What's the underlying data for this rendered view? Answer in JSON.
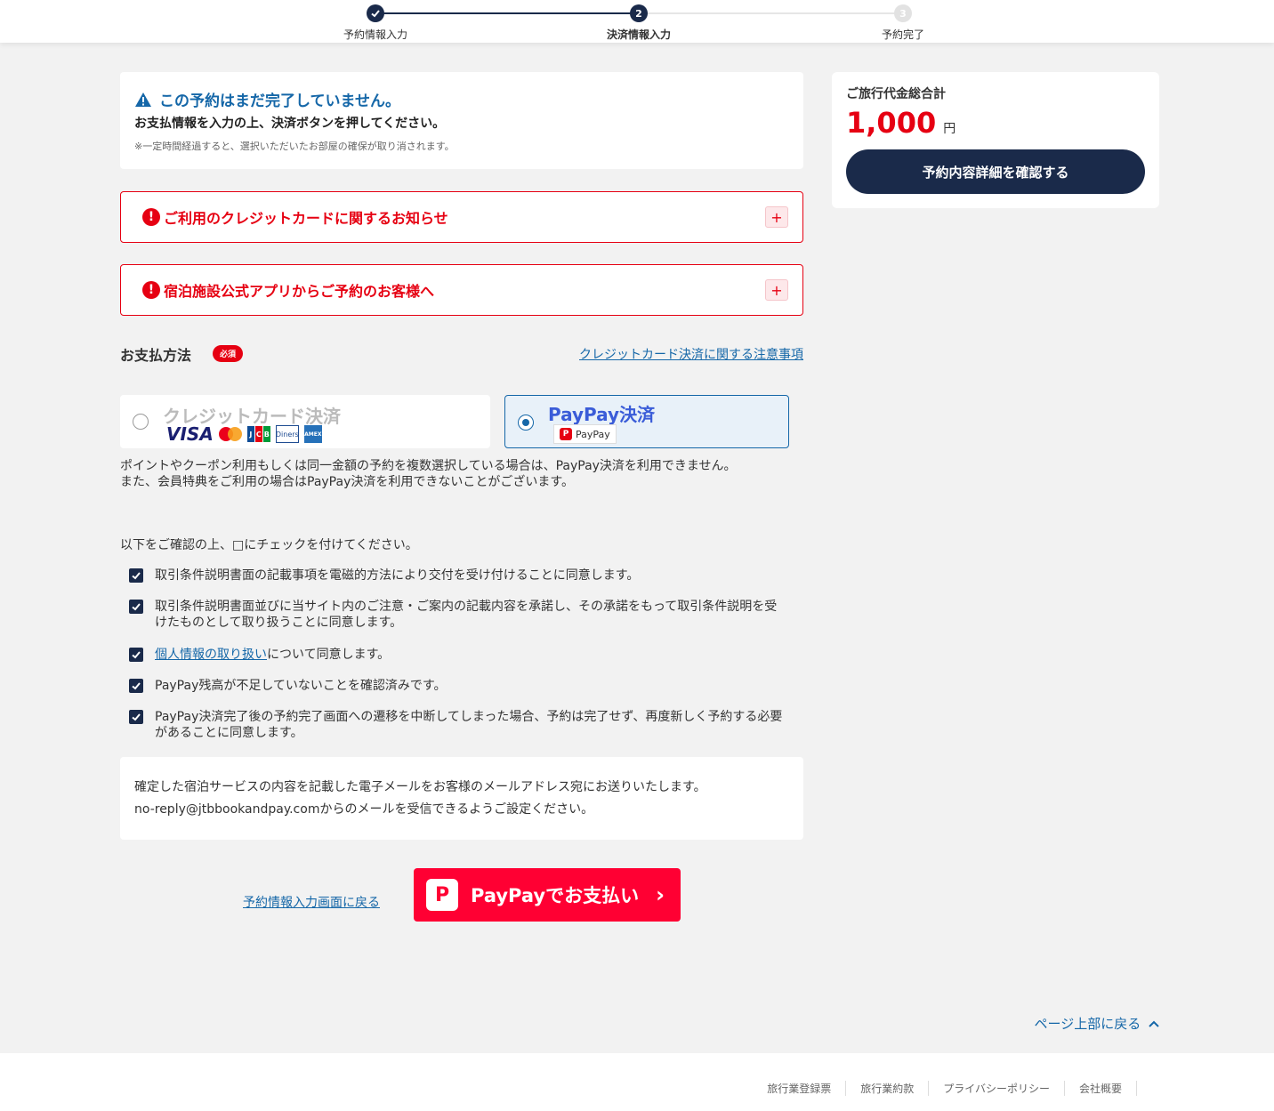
{
  "stepper": {
    "step1_label": "予約情報入力",
    "step2_label": "決済情報入力",
    "step2_number": "2",
    "step3_label": "予約完了",
    "step3_number": "3"
  },
  "notice": {
    "title": "この予約はまだ完了していません。",
    "subtitle": "お支払情報を入力の上、決済ボタンを押してください。",
    "small": "※一定時間経過すると、選択いただいたお部屋の確保が取り消されます。"
  },
  "accordions": [
    {
      "label": "ご利用のクレジットカードに関するお知らせ"
    },
    {
      "label": "宿泊施設公式アプリからご予約のお客様へ"
    }
  ],
  "payment": {
    "title": "お支払方法",
    "required_badge": "必須",
    "notes_link": "クレジットカード決済に関する注意事項",
    "credit_label": "クレジットカード決済",
    "paypay_label": "PayPay決済",
    "paypay_logo_text": "PayPay",
    "card_brands": {
      "visa": "VISA",
      "jcb": [
        "J",
        "C",
        "B"
      ],
      "diners": "Diners",
      "amex": "AMEX"
    },
    "selected": "paypay",
    "note_line1": "ポイントやクーポン利用もしくは同一金額の予約を複数選択している場合は、PayPay決済を利用できません。",
    "note_line2": "また、会員特典をご利用の場合はPayPay決済を利用できないことがございます。"
  },
  "checklist": {
    "intro": "以下をご確認の上、□にチェックを付けてください。",
    "items": [
      {
        "text": "取引条件説明書面の記載事項を電磁的方法により交付を受け付けることに同意します。",
        "checked": true
      },
      {
        "text": "取引条件説明書面並びに当サイト内のご注意・ご案内の記載内容を承諾し、その承諾をもって取引条件説明を受けたものとして取り扱うことに同意します。",
        "checked": true
      },
      {
        "link": "個人情報の取り扱い",
        "text": "について同意します。",
        "checked": true
      },
      {
        "text": "PayPay残高が不足していないことを確認済みです。",
        "checked": true
      },
      {
        "text": "PayPay決済完了後の予約完了画面への遷移を中断してしまった場合、予約は完了せず、再度新しく予約する必要があることに同意します。",
        "checked": true
      }
    ]
  },
  "email_info": {
    "line1": "確定した宿泊サービスの内容を記載した電子メールをお客様のメールアドレス宛にお送りいたします。",
    "line2": "no-reply@jtbbookandpay.comからのメールを受信できるようご設定ください。"
  },
  "actions": {
    "back_link": "予約情報入力画面に戻る",
    "paypay_button": "PayPayでお支払い",
    "paypay_button_logo": "P"
  },
  "summary": {
    "title": "ご旅行代金総合計",
    "amount": "1,000",
    "currency": "円",
    "detail_button": "予約内容詳細を確認する"
  },
  "page_top": "ページ上部に戻る",
  "footer": {
    "links": [
      "旅行業登録票",
      "旅行業約款",
      "プライバシーポリシー",
      "会社概要"
    ]
  },
  "colors": {
    "navy": "#1a2a4a",
    "link_blue": "#1567a8",
    "alert_red": "#e60012",
    "paypay_red": "#ff0033"
  }
}
